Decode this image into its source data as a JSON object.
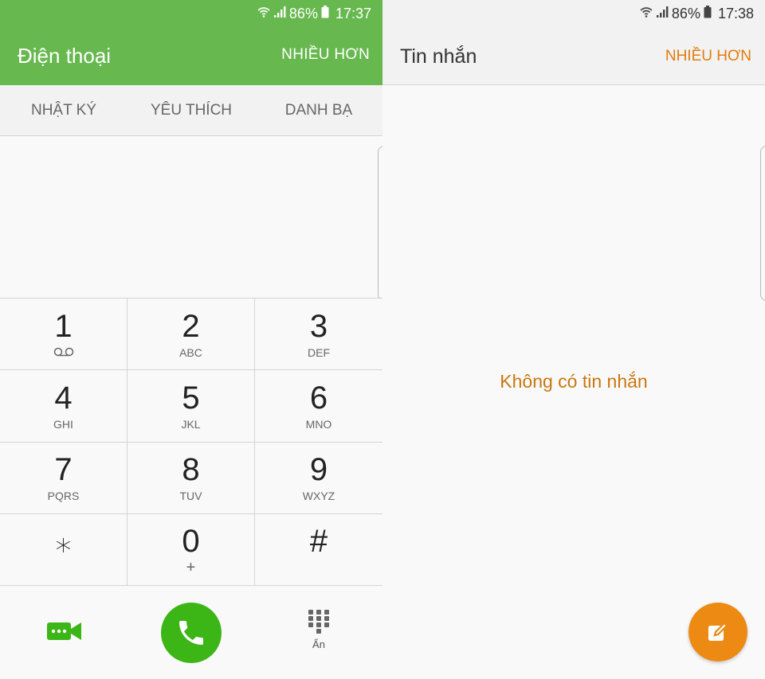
{
  "phone": {
    "status": {
      "battery": "86%",
      "time": "17:37"
    },
    "title": "Điện thoại",
    "more_label": "NHIỀU HƠN",
    "tabs": [
      {
        "label": "NHẬT KÝ"
      },
      {
        "label": "YÊU THÍCH"
      },
      {
        "label": "DANH BẠ"
      }
    ],
    "keys": [
      {
        "digit": "1",
        "letters": ""
      },
      {
        "digit": "2",
        "letters": "ABC"
      },
      {
        "digit": "3",
        "letters": "DEF"
      },
      {
        "digit": "4",
        "letters": "GHI"
      },
      {
        "digit": "5",
        "letters": "JKL"
      },
      {
        "digit": "6",
        "letters": "MNO"
      },
      {
        "digit": "7",
        "letters": "PQRS"
      },
      {
        "digit": "8",
        "letters": "TUV"
      },
      {
        "digit": "9",
        "letters": "WXYZ"
      },
      {
        "digit": "⁎",
        "letters": ""
      },
      {
        "digit": "0",
        "letters": "+"
      },
      {
        "digit": "#",
        "letters": ""
      }
    ],
    "hide_label": "Ẩn",
    "colors": {
      "header": "#67b84f",
      "call_button": "#3cb517"
    },
    "icons": [
      "wifi-icon",
      "signal-icon",
      "battery-icon",
      "voicemail-icon",
      "video-call-icon",
      "phone-icon",
      "dialpad-icon"
    ]
  },
  "messages": {
    "status": {
      "battery": "86%",
      "time": "17:38"
    },
    "title": "Tin nhắn",
    "more_label": "NHIỀU HƠN",
    "empty_text": "Không có tin nhắn",
    "colors": {
      "accent": "#ec8a14"
    },
    "icons": [
      "compose-icon"
    ]
  }
}
